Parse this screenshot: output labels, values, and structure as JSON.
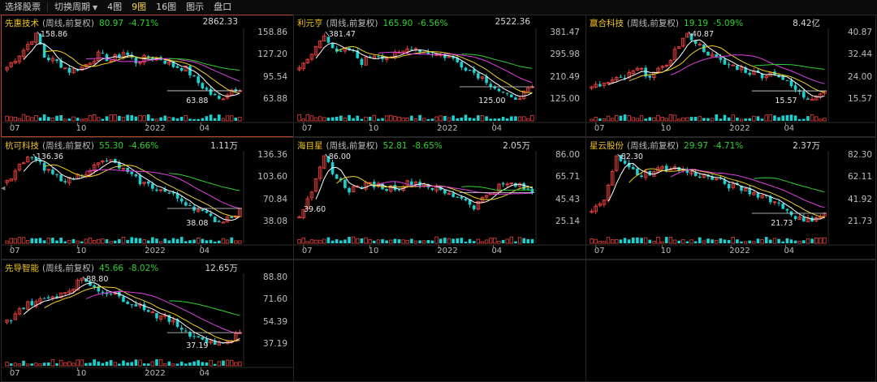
{
  "toolbar": {
    "items": [
      "选择股票",
      "切换周期",
      "4图",
      "9图",
      "16图",
      "图示",
      "盘口"
    ],
    "active_index": 3,
    "dropdown_index": 1
  },
  "colors": {
    "up": "#e8413d",
    "down": "#1ad0d0",
    "ma5": "#ffffff",
    "ma10": "#f0d020",
    "ma20": "#e040e0",
    "ma60": "#30d030",
    "name": "#f0c420",
    "fall": "#2ed32e",
    "selected_border": "#b4442a"
  },
  "x_labels": [
    "07",
    "10",
    "2022",
    "04"
  ],
  "panels": [
    {
      "name": "先惠技术",
      "mode": "(周线,前复权)",
      "price": "80.97",
      "change": "-4.71%",
      "volume": "2862.33",
      "y_labels": [
        "158.86",
        "127.20",
        "95.54",
        "63.88"
      ],
      "high_label": "158.86",
      "low_label": "63.88",
      "selected": true,
      "chart_data": {
        "type": "candlestick",
        "ylim": [
          63.88,
          158.86
        ],
        "high": 158.86,
        "low": 63.88,
        "anchors": [
          [
            0,
            110
          ],
          [
            4,
            135
          ],
          [
            7,
            158.86
          ],
          [
            9,
            125
          ],
          [
            12,
            118
          ],
          [
            15,
            105
          ],
          [
            18,
            110
          ],
          [
            22,
            128
          ],
          [
            25,
            120
          ],
          [
            28,
            132
          ],
          [
            31,
            118
          ],
          [
            34,
            125
          ],
          [
            37,
            122
          ],
          [
            40,
            112
          ],
          [
            43,
            108
          ],
          [
            46,
            88
          ],
          [
            49,
            72
          ],
          [
            51,
            63.88
          ],
          [
            54,
            78
          ],
          [
            56,
            81
          ]
        ]
      }
    },
    {
      "name": "利元亨",
      "mode": "(周线,前复权)",
      "price": "165.90",
      "change": "-6.56%",
      "volume": "2522.36",
      "y_labels": [
        "381.47",
        "295.98",
        "210.49",
        "125.00"
      ],
      "high_label": "381.47",
      "low_label": "125.00",
      "selected": false,
      "chart_data": {
        "type": "candlestick",
        "ylim": [
          125,
          381.47
        ],
        "high": 381.47,
        "low": 125,
        "anchors": [
          [
            0,
            240
          ],
          [
            3,
            300
          ],
          [
            6,
            381.47
          ],
          [
            9,
            300
          ],
          [
            12,
            320
          ],
          [
            15,
            270
          ],
          [
            18,
            300
          ],
          [
            21,
            290
          ],
          [
            24,
            300
          ],
          [
            27,
            330
          ],
          [
            30,
            310
          ],
          [
            33,
            300
          ],
          [
            36,
            290
          ],
          [
            39,
            260
          ],
          [
            42,
            230
          ],
          [
            45,
            200
          ],
          [
            48,
            160
          ],
          [
            51,
            125
          ],
          [
            54,
            150
          ],
          [
            56,
            166
          ]
        ]
      }
    },
    {
      "name": "赢合科技",
      "mode": "(周线,前复权)",
      "price": "19.19",
      "change": "-5.09%",
      "volume": "8.42亿",
      "y_labels": [
        "40.87",
        "32.44",
        "24.00",
        "15.57"
      ],
      "high_label": "40.87",
      "low_label": "15.57",
      "selected": false,
      "chart_data": {
        "type": "candlestick",
        "ylim": [
          15.57,
          40.87
        ],
        "high": 40.87,
        "low": 15.57,
        "anchors": [
          [
            0,
            20
          ],
          [
            4,
            22
          ],
          [
            8,
            24
          ],
          [
            11,
            27
          ],
          [
            14,
            25
          ],
          [
            17,
            27
          ],
          [
            20,
            34
          ],
          [
            23,
            40.87
          ],
          [
            26,
            36
          ],
          [
            29,
            32
          ],
          [
            32,
            29
          ],
          [
            35,
            28
          ],
          [
            38,
            26
          ],
          [
            41,
            25
          ],
          [
            44,
            26
          ],
          [
            47,
            22
          ],
          [
            50,
            18
          ],
          [
            52,
            15.57
          ],
          [
            54,
            18
          ],
          [
            56,
            19.2
          ]
        ]
      }
    },
    {
      "name": "杭可科技",
      "mode": "(周线,前复权)",
      "price": "55.30",
      "change": "-4.66%",
      "volume": "1.11万",
      "y_labels": [
        "136.36",
        "103.60",
        "70.84",
        "38.08"
      ],
      "high_label": "136.36",
      "low_label": "38.08",
      "selected": false,
      "chart_data": {
        "type": "candlestick",
        "ylim": [
          38.08,
          136.36
        ],
        "high": 136.36,
        "low": 38.08,
        "anchors": [
          [
            0,
            95
          ],
          [
            3,
            120
          ],
          [
            6,
            136.36
          ],
          [
            9,
            115
          ],
          [
            12,
            105
          ],
          [
            15,
            100
          ],
          [
            18,
            110
          ],
          [
            21,
            120
          ],
          [
            24,
            130
          ],
          [
            27,
            120
          ],
          [
            30,
            105
          ],
          [
            33,
            95
          ],
          [
            36,
            88
          ],
          [
            39,
            80
          ],
          [
            42,
            70
          ],
          [
            45,
            60
          ],
          [
            48,
            48
          ],
          [
            51,
            38.08
          ],
          [
            54,
            48
          ],
          [
            56,
            55.3
          ]
        ]
      }
    },
    {
      "name": "海目星",
      "mode": "(周线,前复权)",
      "price": "52.81",
      "change": "-8.65%",
      "volume": "2.05万",
      "y_labels": [
        "86.00",
        "65.71",
        "45.43",
        "25.14"
      ],
      "high_label": "86.00",
      "low_label": "39.60",
      "selected": false,
      "chart_data": {
        "type": "candlestick",
        "ylim": [
          25.14,
          86
        ],
        "high": 86,
        "low": 39.6,
        "anchors": [
          [
            0,
            32
          ],
          [
            3,
            50
          ],
          [
            6,
            86
          ],
          [
            9,
            65
          ],
          [
            12,
            55
          ],
          [
            15,
            58
          ],
          [
            18,
            60
          ],
          [
            21,
            56
          ],
          [
            24,
            58
          ],
          [
            27,
            62
          ],
          [
            30,
            60
          ],
          [
            33,
            55
          ],
          [
            36,
            50
          ],
          [
            39,
            48
          ],
          [
            42,
            39.6
          ],
          [
            45,
            50
          ],
          [
            48,
            58
          ],
          [
            51,
            60
          ],
          [
            54,
            56
          ],
          [
            56,
            52.8
          ]
        ]
      }
    },
    {
      "name": "星云股份",
      "mode": "(周线,前复权)",
      "price": "29.97",
      "change": "-4.71%",
      "volume": "2.37万",
      "y_labels": [
        "82.30",
        "62.11",
        "41.92",
        "21.73"
      ],
      "high_label": "82.30",
      "low_label": "21.73",
      "selected": false,
      "chart_data": {
        "type": "candlestick",
        "ylim": [
          21.73,
          82.3
        ],
        "high": 82.3,
        "low": 21.73,
        "anchors": [
          [
            0,
            30
          ],
          [
            3,
            45
          ],
          [
            6,
            82.3
          ],
          [
            9,
            70
          ],
          [
            12,
            65
          ],
          [
            15,
            68
          ],
          [
            18,
            72
          ],
          [
            21,
            70
          ],
          [
            24,
            66
          ],
          [
            27,
            64
          ],
          [
            30,
            60
          ],
          [
            33,
            55
          ],
          [
            36,
            52
          ],
          [
            39,
            48
          ],
          [
            42,
            45
          ],
          [
            45,
            38
          ],
          [
            48,
            30
          ],
          [
            51,
            21.73
          ],
          [
            54,
            27
          ],
          [
            56,
            30
          ]
        ]
      }
    },
    {
      "name": "先导智能",
      "mode": "(周线,前复权)",
      "price": "45.66",
      "change": "-8.02%",
      "volume": "12.65万",
      "y_labels": [
        "88.80",
        "71.60",
        "54.39",
        "37.19"
      ],
      "high_label": "88.80",
      "low_label": "37.19",
      "selected": false,
      "chart_data": {
        "type": "candlestick",
        "ylim": [
          37.19,
          88.8
        ],
        "high": 88.8,
        "low": 37.19,
        "anchors": [
          [
            0,
            55
          ],
          [
            3,
            65
          ],
          [
            6,
            70
          ],
          [
            9,
            72
          ],
          [
            12,
            76
          ],
          [
            15,
            80
          ],
          [
            18,
            88.8
          ],
          [
            21,
            82
          ],
          [
            24,
            78
          ],
          [
            27,
            74
          ],
          [
            30,
            70
          ],
          [
            33,
            66
          ],
          [
            36,
            60
          ],
          [
            39,
            56
          ],
          [
            42,
            50
          ],
          [
            45,
            44
          ],
          [
            48,
            40
          ],
          [
            51,
            37.19
          ],
          [
            54,
            42
          ],
          [
            56,
            45.7
          ]
        ]
      }
    }
  ]
}
